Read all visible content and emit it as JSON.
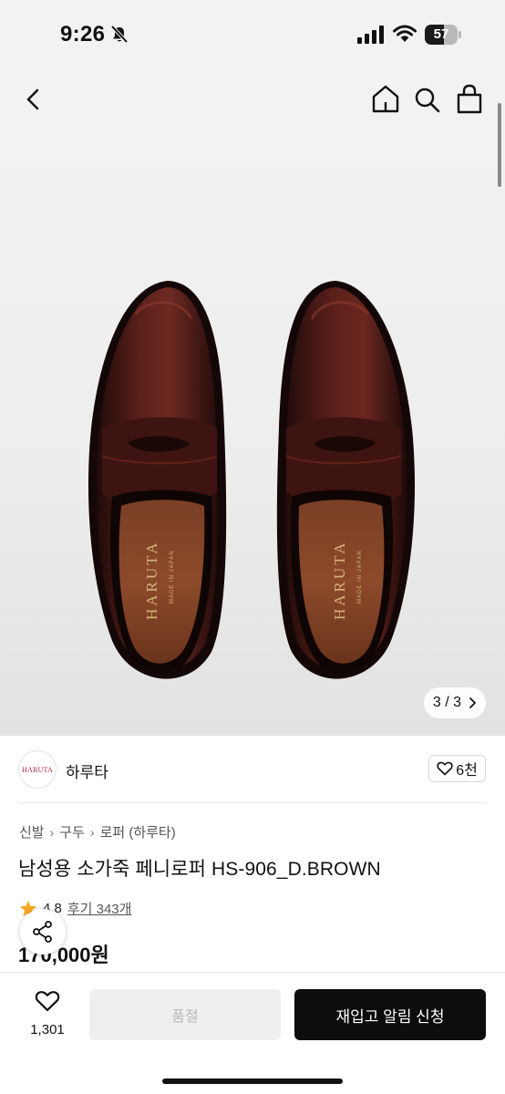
{
  "status_bar": {
    "time": "9:26",
    "battery_level": "57",
    "battery_fraction": 0.57,
    "icons": [
      "bell-slash-icon",
      "signal-icon",
      "wifi-icon",
      "battery-icon"
    ]
  },
  "top_nav": {
    "icons": [
      "chevron-left-icon",
      "home-icon",
      "search-icon",
      "shopping-bag-icon"
    ]
  },
  "gallery": {
    "counter_current": "3",
    "counter_separator": "/",
    "counter_total": "3",
    "insole_brand": "HARUTA",
    "insole_sub": "MADE IN JAPAN"
  },
  "brand": {
    "logo_text": "HARUTA",
    "name": "하루타",
    "like_count": "6천"
  },
  "product": {
    "breadcrumb": [
      "신발",
      "구두",
      "로퍼 (하루타)"
    ],
    "title": "남성용 소가죽 페니로퍼 HS-906_D.BROWN",
    "rating": "4.8",
    "review_label": "후기 343개",
    "price": "170,000원"
  },
  "bottom_bar": {
    "wish_count": "1,301",
    "soldout_label": "품절",
    "restock_label": "재입고 알림 신청"
  },
  "colors": {
    "accent_black": "#0d0d0d",
    "star": "#f5a623",
    "brand_red": "#b0243a",
    "leather": "#4a1c17"
  }
}
